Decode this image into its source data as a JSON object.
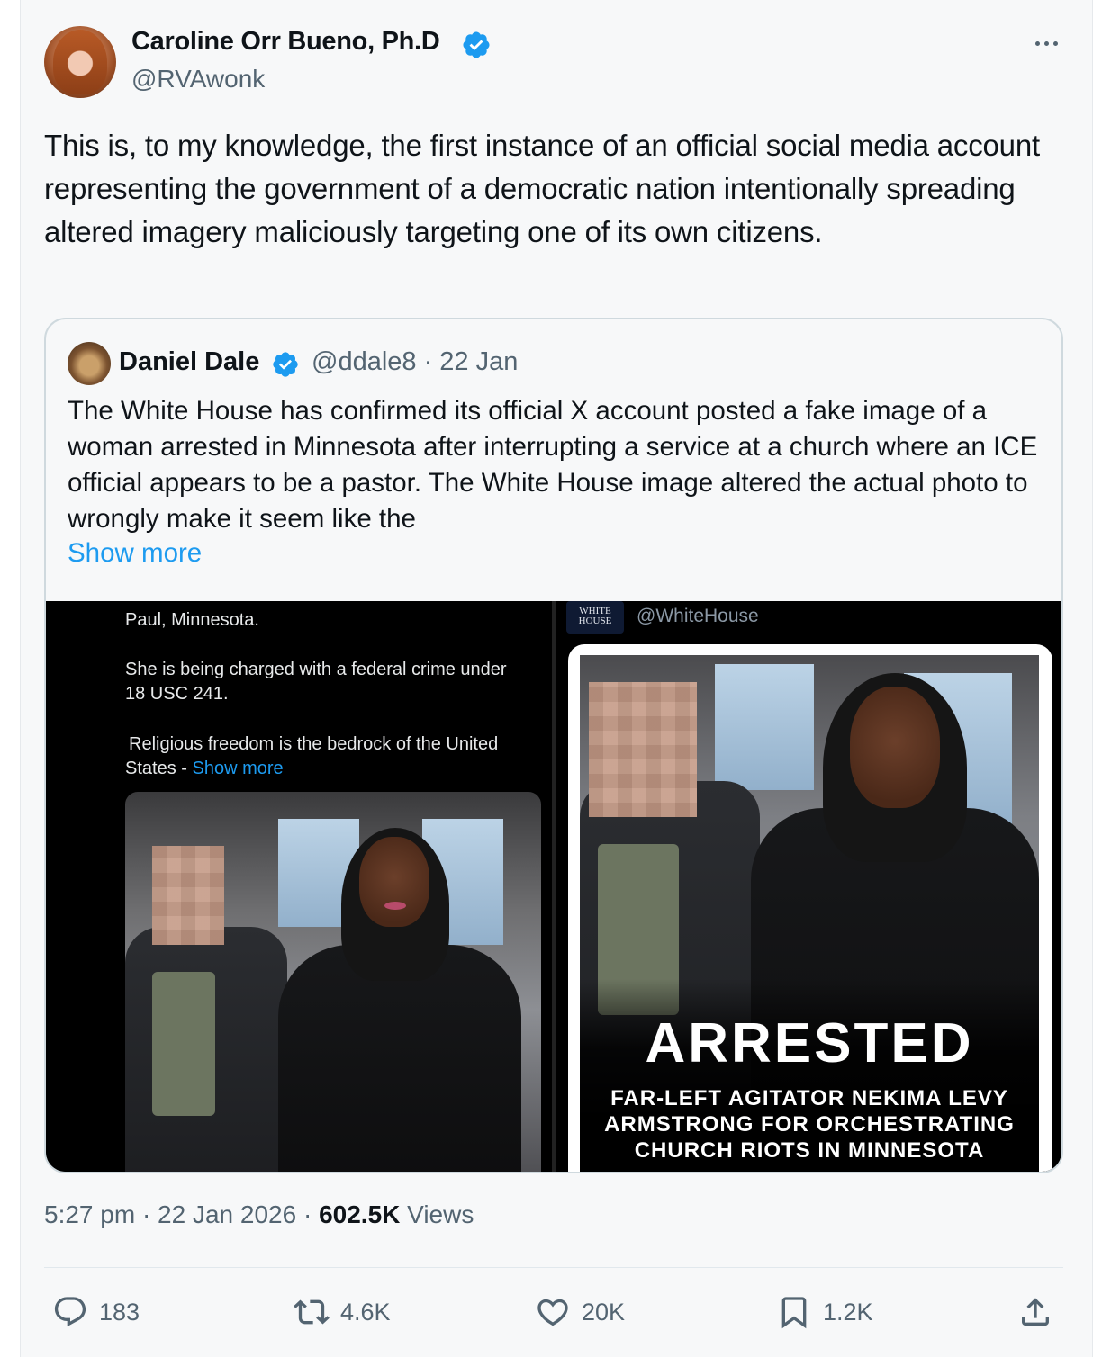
{
  "author": {
    "name": "Caroline Orr Bueno, Ph.D",
    "handle": "@RVAwonk"
  },
  "tweet": {
    "text": "This is, to my knowledge, the first instance of an official social media account representing the government of a democratic nation intentionally spreading altered imagery maliciously targeting one of its own citizens."
  },
  "quote": {
    "name": "Daniel Dale",
    "handle_date": "@ddale8 · 22 Jan",
    "text": "The White House has confirmed its official X account posted a fake image of a woman arrested in Minnesota after interrupting a service at a church where an ICE official appears to be a pastor. The White House image altered the actual photo to wrongly make it seem like the",
    "show_more": "Show more"
  },
  "media": {
    "left": {
      "line1": "Paul, Minnesota.",
      "line2a": "She is being charged with a federal crime under",
      "line2b": "18 USC 241.",
      "line3a": "Religious freedom is the bedrock of the United",
      "line3b": "States - ",
      "line3_link": "Show more"
    },
    "right": {
      "logo_text": "WHITE HOUSE",
      "handle": "@WhiteHouse",
      "headline": "ARRESTED",
      "sub1": "FAR-LEFT AGITATOR NEKIMA LEVY",
      "sub2": "ARMSTRONG FOR ORCHESTRATING",
      "sub3": "CHURCH RIOTS IN MINNESOTA"
    }
  },
  "meta": {
    "time_date": "5:27 pm · 22 Jan 2026 · ",
    "views_count": "602.5K",
    "views_label": " Views"
  },
  "actions": {
    "replies": "183",
    "reposts": "4.6K",
    "likes": "20K",
    "bookmarks": "1.2K"
  },
  "colors": {
    "accent": "#1d9bf0",
    "secondary_text": "#536471",
    "text": "#0f1419"
  }
}
